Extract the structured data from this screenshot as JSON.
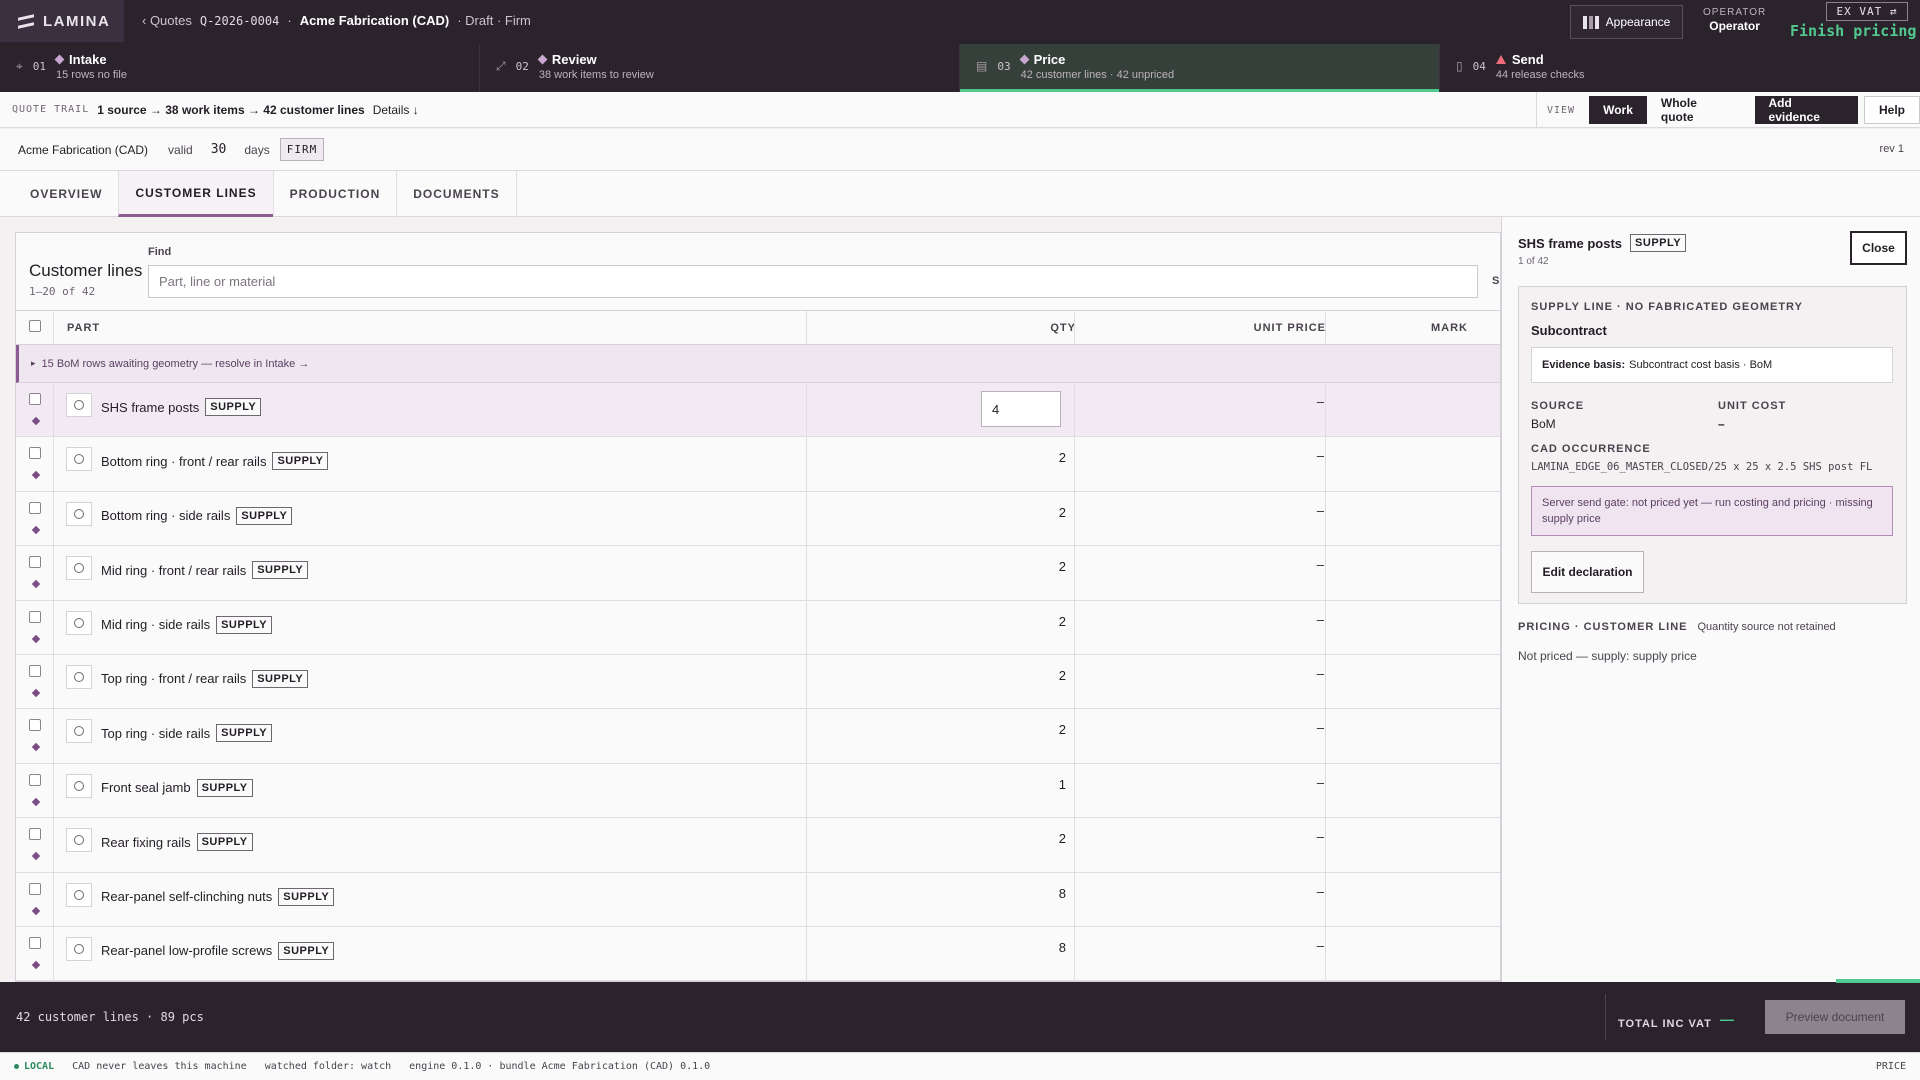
{
  "app": {
    "logo": "LAMINA"
  },
  "breadcrumb": {
    "back": "‹ Quotes",
    "quote_id": "Q-2026-0004",
    "client": "Acme Fabrication (CAD)",
    "state": "· Draft · Firm"
  },
  "topbar": {
    "appearance": "Appearance",
    "operator_label": "OPERATOR",
    "operator_value": "Operator",
    "vat_toggle": "EX VAT ⇄",
    "finish": "Finish pricing"
  },
  "steps": [
    {
      "num": "01",
      "title": "Intake",
      "sub": "15 rows no file",
      "icon": "⌖"
    },
    {
      "num": "02",
      "title": "Review",
      "sub": "38 work items to review",
      "icon": "⤢"
    },
    {
      "num": "03",
      "title": "Price",
      "sub": "42 customer lines · 42 unpriced",
      "icon": "▤"
    },
    {
      "num": "04",
      "title": "Send",
      "sub": "44 release checks",
      "icon": "▯"
    }
  ],
  "trail": {
    "label": "QUOTE TRAIL",
    "summary": "1 source → 38 work items → 42 customer lines",
    "details": "Details ↓",
    "view_label": "VIEW",
    "view_work": "Work",
    "view_whole": "Whole quote",
    "add_evidence": "Add evidence",
    "help": "Help"
  },
  "meta": {
    "client": "Acme Fabrication (CAD)",
    "valid_label": "valid",
    "valid_days": "30",
    "days_label": "days",
    "firm": "FIRM",
    "rev": "rev 1"
  },
  "tabs": [
    "OVERVIEW",
    "CUSTOMER LINES",
    "PRODUCTION",
    "DOCUMENTS"
  ],
  "table": {
    "title": "Customer lines",
    "count": "1–20 of 42",
    "find_label": "Find",
    "find_placeholder": "Part, line or material",
    "find_extra": "S",
    "columns": {
      "part": "PART",
      "qty": "QTY",
      "unit_price": "UNIT PRICE",
      "mark": "MARK"
    },
    "group_note": "15 BoM rows awaiting geometry — resolve in Intake →",
    "group_toggle": "▸",
    "rows": [
      {
        "part": "SHS frame posts",
        "badge": "SUPPLY",
        "qty": "4",
        "price": "–"
      },
      {
        "part": "Bottom ring · front / rear rails",
        "badge": "SUPPLY",
        "qty": "2",
        "price": "–"
      },
      {
        "part": "Bottom ring · side rails",
        "badge": "SUPPLY",
        "qty": "2",
        "price": "–"
      },
      {
        "part": "Mid ring · front / rear rails",
        "badge": "SUPPLY",
        "qty": "2",
        "price": "–"
      },
      {
        "part": "Mid ring · side rails",
        "badge": "SUPPLY",
        "qty": "2",
        "price": "–"
      },
      {
        "part": "Top ring · front / rear rails",
        "badge": "SUPPLY",
        "qty": "2",
        "price": "–"
      },
      {
        "part": "Top ring · side rails",
        "badge": "SUPPLY",
        "qty": "2",
        "price": "–"
      },
      {
        "part": "Front seal jamb",
        "badge": "SUPPLY",
        "qty": "1",
        "price": "–"
      },
      {
        "part": "Rear fixing rails",
        "badge": "SUPPLY",
        "qty": "2",
        "price": "–"
      },
      {
        "part": "Rear-panel self-clinching nuts",
        "badge": "SUPPLY",
        "qty": "8",
        "price": "–"
      },
      {
        "part": "Rear-panel low-profile screws",
        "badge": "SUPPLY",
        "qty": "8",
        "price": "–"
      }
    ]
  },
  "side": {
    "title": "SHS frame posts",
    "badge": "SUPPLY",
    "position": "1 of 42",
    "close": "Close",
    "card_heading": "SUPPLY LINE · NO FABRICATED GEOMETRY",
    "card_sub": "Subcontract",
    "evidence_label": "Evidence basis:",
    "evidence_value": "Subcontract cost basis · BoM",
    "source_label": "SOURCE",
    "source_value": "BoM",
    "unit_cost_label": "UNIT COST",
    "unit_cost_value": "–",
    "cad_label": "CAD OCCURRENCE",
    "cad_value": "LAMINA_EDGE_06_MASTER_CLOSED/25 x 25 x 2.5 SHS post FL",
    "gate": "Server send gate: not priced yet — run costing and pricing · missing supply price",
    "edit": "Edit declaration",
    "pricing_label": "PRICING · CUSTOMER LINE",
    "pricing_note": "Quantity source not retained",
    "pricing_value": "Not priced — supply: supply price"
  },
  "footer": {
    "summary": "42 customer lines · 89 pcs",
    "total_label": "TOTAL INC VAT",
    "total_value": "—",
    "preview": "Preview document"
  },
  "status": {
    "local": "LOCAL",
    "cad_note": "CAD never leaves this machine",
    "watched": "watched folder: watch",
    "engine": "engine 0.1.0 · bundle Acme Fabrication (CAD) 0.1.0",
    "mode": "PRICE"
  },
  "colors": {
    "accent": "#8a5c93",
    "ok": "#52c98e",
    "dark": "#2a232c"
  }
}
